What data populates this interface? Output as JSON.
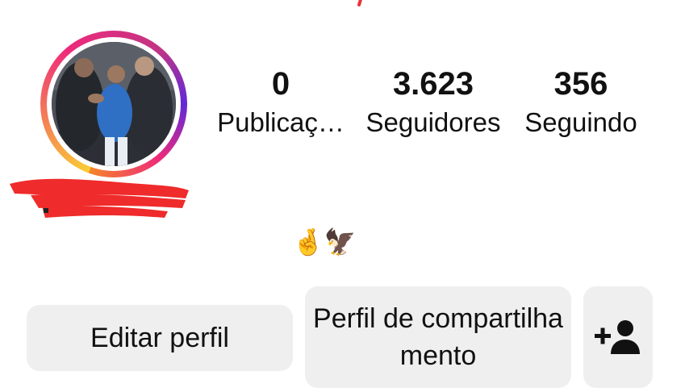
{
  "profile": {
    "stats": [
      {
        "value": "0",
        "label": "Publicaç…"
      },
      {
        "value": "3.623",
        "label": "Seguidores"
      },
      {
        "value": "356",
        "label": "Seguindo"
      }
    ],
    "bio_emoji": "🤞🦅"
  },
  "actions": {
    "edit_label": "Editar perfil",
    "share_label": "Perfil de compartilhamento",
    "add_person_icon": "person-add-icon"
  },
  "colors": {
    "ring_gradient": [
      "#f9ce34",
      "#ee2a7b",
      "#6228d7",
      "#f58529"
    ],
    "button_bg": "#efefef",
    "redaction": "#ef2b2b"
  }
}
